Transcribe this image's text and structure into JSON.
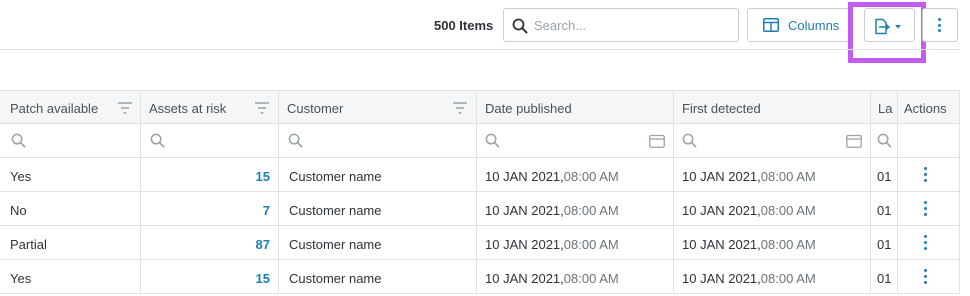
{
  "toolbar": {
    "item_count": "500 Items",
    "search_placeholder": "Search...",
    "columns_label": "Columns"
  },
  "table": {
    "headers": {
      "patch_available": "Patch available",
      "assets_at_risk": "Assets at risk",
      "customer": "Customer",
      "date_published": "Date published",
      "first_detected": "First detected",
      "last": "La",
      "actions": "Actions"
    },
    "rows": [
      {
        "patch": "Yes",
        "assets": "15",
        "customer": "Customer name",
        "published_date": "10 JAN 2021,",
        "published_time": "08:00 AM",
        "detected_date": "10 JAN 2021,",
        "detected_time": "08:00 AM",
        "last": "01"
      },
      {
        "patch": "No",
        "assets": "7",
        "customer": "Customer name",
        "published_date": "10 JAN 2021,",
        "published_time": "08:00 AM",
        "detected_date": "10 JAN 2021,",
        "detected_time": "08:00 AM",
        "last": "01"
      },
      {
        "patch": "Partial",
        "assets": "87",
        "customer": "Customer name",
        "published_date": "10 JAN 2021,",
        "published_time": "08:00 AM",
        "detected_date": "10 JAN 2021,",
        "detected_time": "08:00 AM",
        "last": "01"
      },
      {
        "patch": "Yes",
        "assets": "15",
        "customer": "Customer name",
        "published_date": "10 JAN 2021,",
        "published_time": "08:00 AM",
        "detected_date": "10 JAN 2021,",
        "detected_time": "08:00 AM",
        "last": "01"
      }
    ]
  },
  "colors": {
    "accent": "#1f7fb5",
    "highlight": "#c25cf0",
    "border": "#dfe3e6",
    "header_bg": "#f4f6f7"
  },
  "icons": [
    "search-icon",
    "columns-icon",
    "export-icon",
    "more-vertical-icon",
    "filter-icon",
    "calendar-icon",
    "row-actions-icon"
  ]
}
